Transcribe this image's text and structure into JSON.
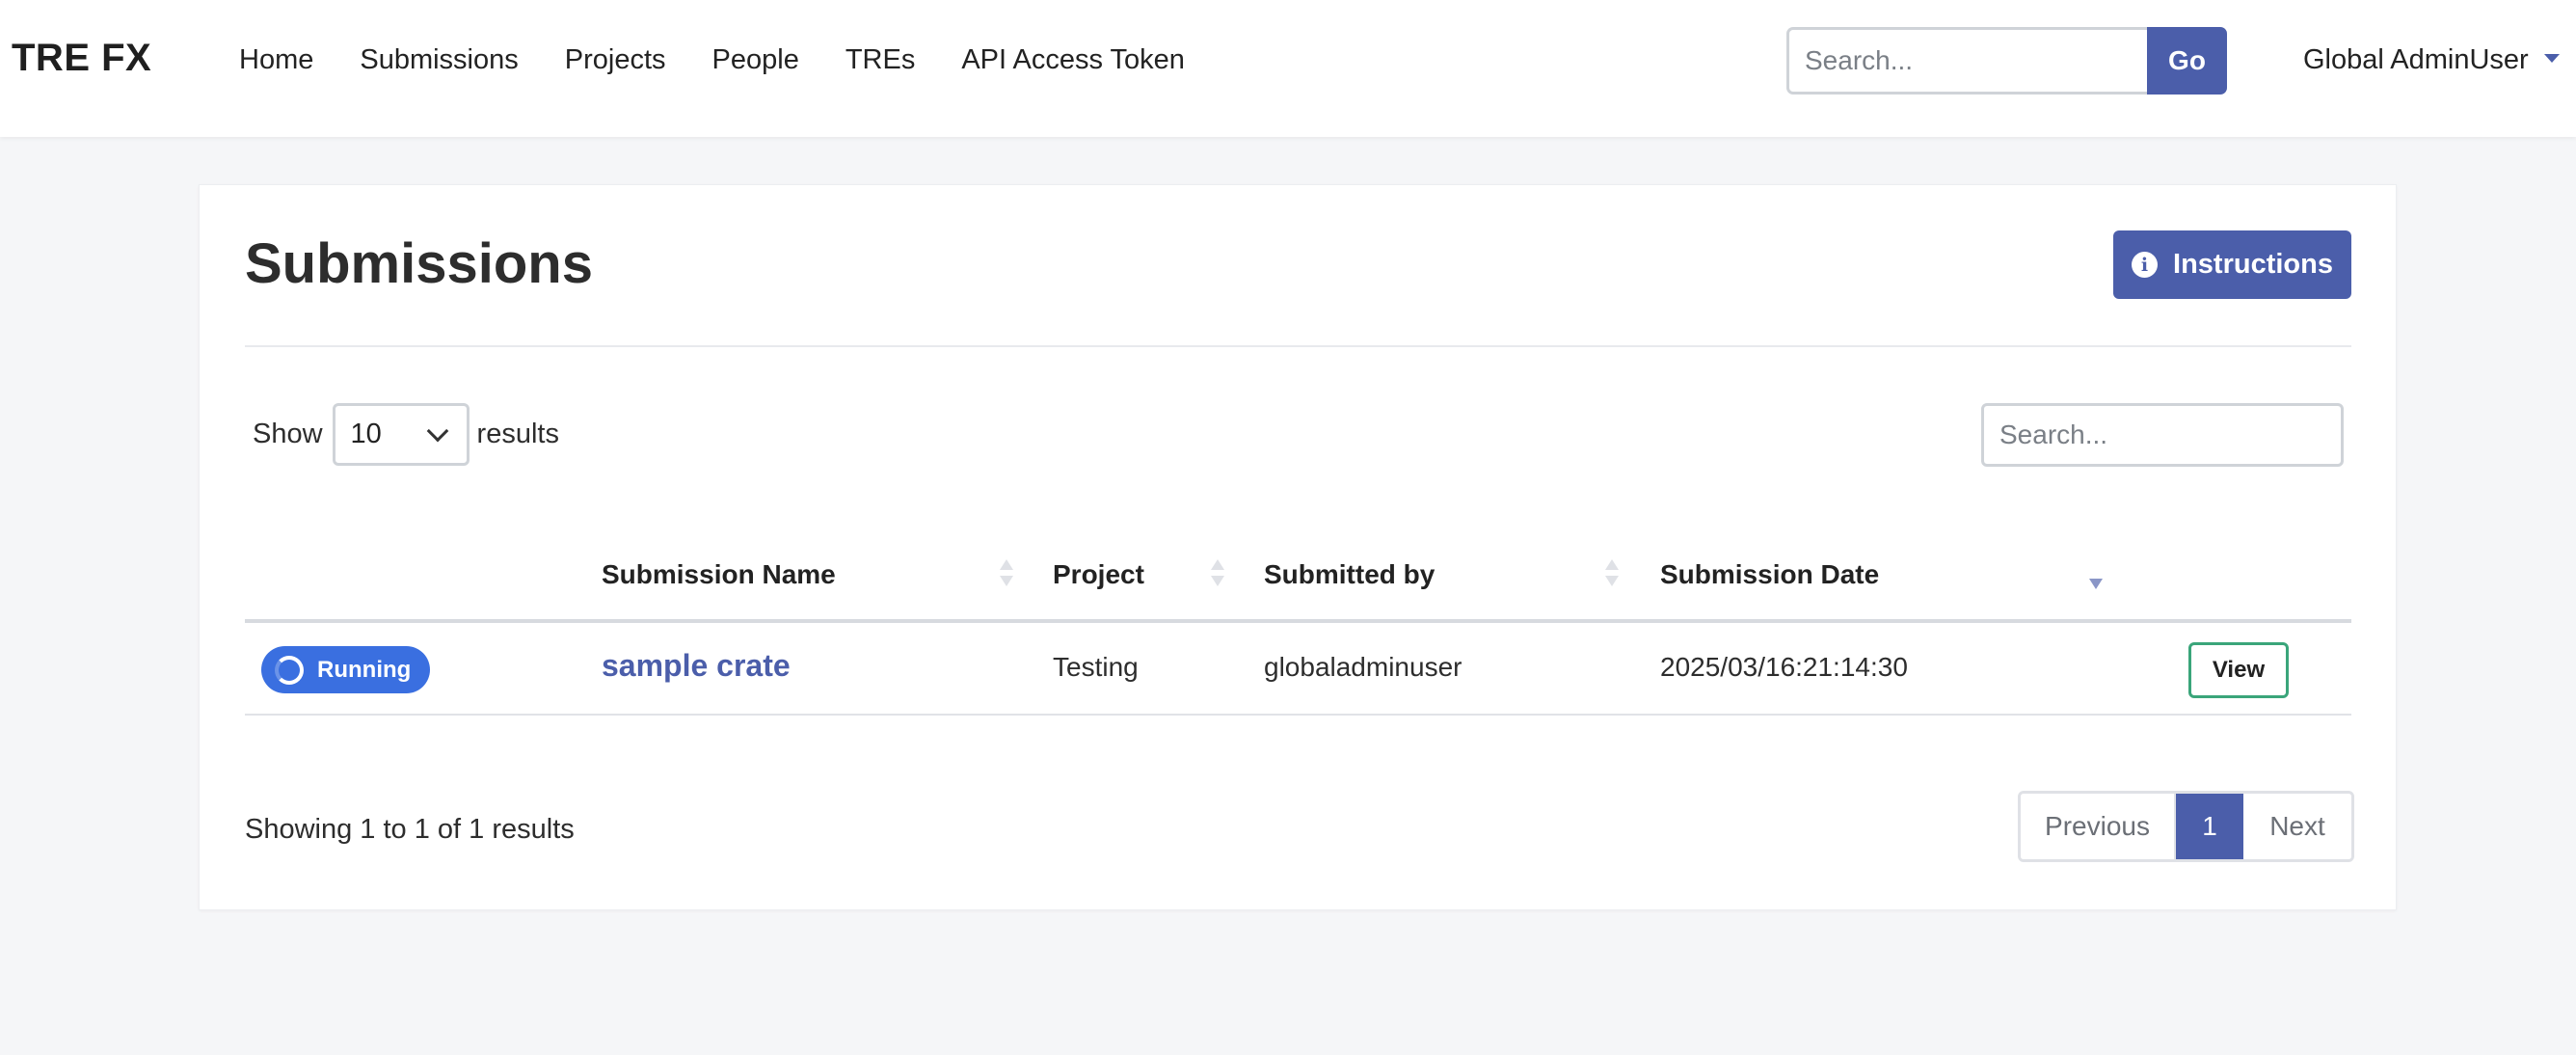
{
  "navbar": {
    "brand": "TRE FX",
    "links": [
      "Home",
      "Submissions",
      "Projects",
      "People",
      "TREs",
      "API Access Token"
    ],
    "search_placeholder": "Search...",
    "go_label": "Go",
    "user": "Global AdminUser"
  },
  "page": {
    "title": "Submissions",
    "instructions_label": "Instructions",
    "show_label": "Show",
    "page_size": "10",
    "results_label": "results",
    "search_placeholder": "Search..."
  },
  "table": {
    "columns": [
      "Submission Name",
      "Project",
      "Submitted by",
      "Submission Date"
    ],
    "sorted_column": "Submission Date",
    "sort_direction": "descending",
    "rows": [
      {
        "status": "Running",
        "name": "sample crate",
        "project": "Testing",
        "submitted_by": "globaladminuser",
        "date": "2025/03/16:21:14:30",
        "action": "View"
      }
    ]
  },
  "footer": {
    "info": "Showing 1 to 1 of 1 results",
    "previous": "Previous",
    "current_page": "1",
    "next": "Next"
  },
  "colors": {
    "primary": "#4b5eaa",
    "running_badge": "#3a6fe0",
    "view_border": "#3aa57a",
    "background": "#f5f6f8"
  }
}
